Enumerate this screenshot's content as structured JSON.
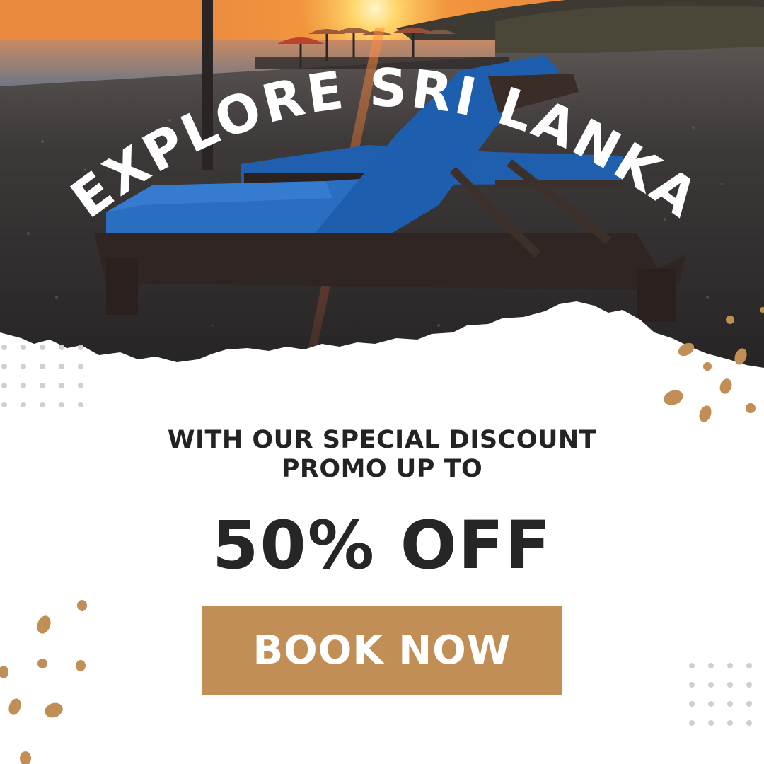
{
  "headline": "EXPLORE SRI LANKA",
  "promo": {
    "line1": "WITH OUR SPECIAL DISCOUNT",
    "line2": "PROMO UP TO",
    "discount": "50% OFF"
  },
  "cta": {
    "label": "BOOK NOW"
  },
  "colors": {
    "accent": "#c18e56",
    "text_dark": "#262626",
    "headline": "#ffffff",
    "dot_pattern": "#cfcfcf"
  }
}
